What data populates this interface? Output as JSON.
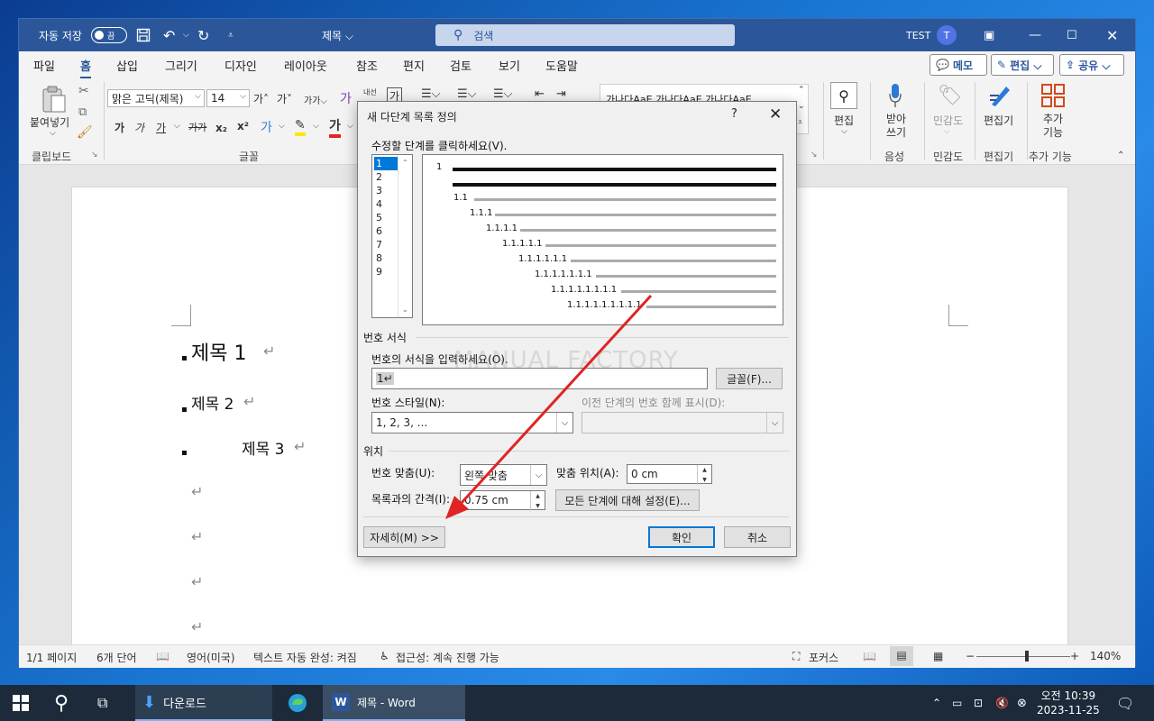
{
  "titlebar": {
    "autosave_label": "자동 저장",
    "autosave_state": "끔",
    "doc_title": "제목 ⌵",
    "search_placeholder": "검색",
    "user_name": "TEST",
    "user_initial": "T"
  },
  "tabs": [
    "파일",
    "홈",
    "삽입",
    "그리기",
    "디자인",
    "레이아웃",
    "참조",
    "편지",
    "검토",
    "보기",
    "도움말"
  ],
  "top_buttons": {
    "memo": "메모",
    "edit": "편집 ⌵",
    "share": "공유 ⌵"
  },
  "ribbon": {
    "paste_label": "붙여넣기",
    "font_name": "맑은 고딕(제목)",
    "font_size": "14",
    "clipboard_group": "클립보드",
    "font_group": "글꼴",
    "styles_sample": "가나다AaE   가나다AaE   가나다AaE",
    "editing_label": "편집",
    "dictate_label": "받아쓰기",
    "sensitivity_label": "민감도",
    "editor_label": "편집기",
    "addins_label": "추가 기능",
    "voice_group": "음성",
    "sensitivity_group": "민감도",
    "editor_group": "편집기",
    "addins_group": "추가 기능"
  },
  "document": {
    "heading1": "제목 1",
    "heading2": "제목 2",
    "heading3": "제목 3",
    "para_mark": "↵"
  },
  "statusbar": {
    "page": "1/1 페이지",
    "words": "6개 단어",
    "language": "영어(미국)",
    "autocomplete": "텍스트 자동 완성: 켜짐",
    "accessibility": "접근성: 계속 진행 가능",
    "focus": "포커스",
    "zoom": "140%"
  },
  "dialog": {
    "title": "새 다단계 목록 정의",
    "help": "?",
    "click_level_label": "수정할 단계를 클릭하세요(V).",
    "levels": [
      "1",
      "2",
      "3",
      "4",
      "5",
      "6",
      "7",
      "8",
      "9"
    ],
    "preview_labels": [
      "1",
      "1.1",
      "1.1.1",
      "1.1.1.1",
      "1.1.1.1.1",
      "1.1.1.1.1.1",
      "1.1.1.1.1.1.1",
      "1.1.1.1.1.1.1.1",
      "1.1.1.1.1.1.1.1.1"
    ],
    "number_format_section": "번호 서식",
    "enter_format_label": "번호의 서식을 입력하세요(O).",
    "format_value": "1↵",
    "font_button": "글꼴(F)...",
    "number_style_label": "번호 스타일(N):",
    "number_style_value": "1, 2, 3, ...",
    "prev_level_label": "이전 단계의 번호 함께 표시(D):",
    "position_section": "위치",
    "alignment_label": "번호 맞춤(U):",
    "alignment_value": "왼쪽 맞춤",
    "align_at_label": "맞춤 위치(A):",
    "align_at_value": "0 cm",
    "indent_label": "목록과의 간격(I):",
    "indent_value": "0.75 cm",
    "set_all_levels_button": "모든 단계에 대해 설정(E)...",
    "more_button": "자세히(M) >>",
    "ok_button": "확인",
    "cancel_button": "취소",
    "watermark": "MANUAL FACTORY"
  },
  "taskbar": {
    "downloads": "다운로드",
    "word": "제목 - Word",
    "time": "오전 10:39",
    "date": "2023-11-25"
  },
  "colors": {
    "word_blue": "#2b579a",
    "annotation_red": "#e02424",
    "selection_blue": "#0078d7"
  }
}
